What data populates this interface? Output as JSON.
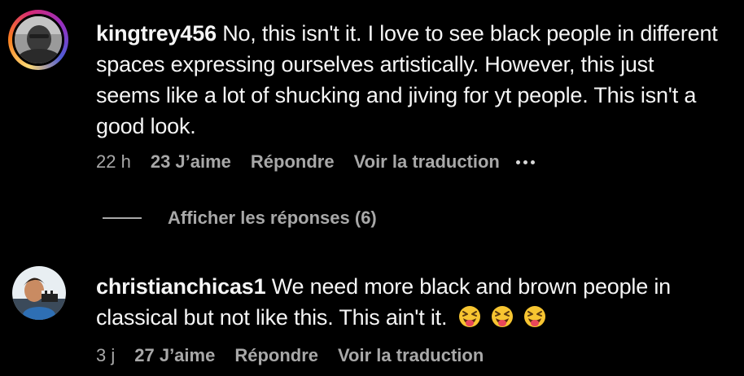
{
  "comments": [
    {
      "username": "kingtrey456",
      "text": " No, this isn't it. I love to see black people in different spaces expressing ourselves artistically. However, this just seems like a lot of shucking and jiving for yt people. This isn't a good look.",
      "time": "22 h",
      "likes": "23 J’aime",
      "reply_label": "Répondre",
      "translate_label": "Voir la traduction",
      "more_icon": "more-horizontal-icon",
      "has_story_ring": true,
      "view_replies": "Afficher les réponses (6)"
    },
    {
      "username": "christianchicas1",
      "text": " We need more black and brown people in classical but not like this. This ain't it. ",
      "emojis": [
        "squinting-face-with-tongue",
        "squinting-face-with-tongue",
        "squinting-face-with-tongue"
      ],
      "time": "3 j",
      "likes": "27 J’aime",
      "reply_label": "Répondre",
      "translate_label": "Voir la traduction",
      "has_story_ring": false
    }
  ],
  "colors": {
    "background": "#000000",
    "text": "#f5f5f5",
    "secondary": "#a8a8a8"
  }
}
